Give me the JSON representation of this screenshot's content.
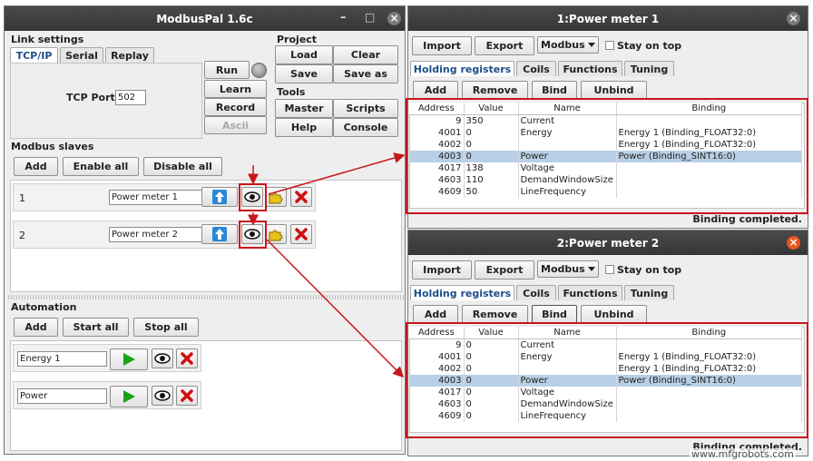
{
  "main_window": {
    "title": "ModbusPal 1.6c",
    "controls": {
      "minimize": "–",
      "maximize": "□",
      "close": "×"
    },
    "link_settings": {
      "label": "Link settings",
      "tabs": [
        "TCP/IP",
        "Serial",
        "Replay"
      ],
      "tcp_port_label": "TCP Port:",
      "tcp_port_value": "502",
      "buttons": {
        "run": "Run",
        "learn": "Learn",
        "record": "Record",
        "ascii": "Ascii"
      }
    },
    "project": {
      "label": "Project",
      "load": "Load",
      "clear": "Clear",
      "save": "Save",
      "save_as": "Save as"
    },
    "tools": {
      "label": "Tools",
      "master": "Master",
      "scripts": "Scripts",
      "help": "Help",
      "console": "Console"
    },
    "modbus_slaves": {
      "label": "Modbus slaves",
      "add": "Add",
      "enable_all": "Enable all",
      "disable_all": "Disable all",
      "slaves": [
        {
          "id": "1",
          "name": "Power meter 1"
        },
        {
          "id": "2",
          "name": "Power meter 2"
        }
      ]
    },
    "automation": {
      "label": "Automation",
      "add": "Add",
      "start_all": "Start all",
      "stop_all": "Stop all",
      "items": [
        {
          "name": "Energy 1"
        },
        {
          "name": "Power"
        }
      ]
    }
  },
  "slave_windows": [
    {
      "title": "1:Power meter 1",
      "import": "Import",
      "export": "Export",
      "protocol": "Modbus",
      "stay_on_top": "Stay on top",
      "tabs": [
        "Holding registers",
        "Coils",
        "Functions",
        "Tuning"
      ],
      "actions": {
        "add": "Add",
        "remove": "Remove",
        "bind": "Bind",
        "unbind": "Unbind"
      },
      "columns": [
        "Address",
        "Value",
        "Name",
        "Binding"
      ],
      "rows": [
        [
          "9",
          "350",
          "Current",
          ""
        ],
        [
          "4001",
          "0",
          "Energy",
          "Energy 1 (Binding_FLOAT32:0)"
        ],
        [
          "4002",
          "0",
          "",
          "Energy 1 (Binding_FLOAT32:0)"
        ],
        [
          "4003",
          "0",
          "Power",
          "Power (Binding_SINT16:0)"
        ],
        [
          "4017",
          "138",
          "Voltage",
          ""
        ],
        [
          "4603",
          "110",
          "DemandWindowSize",
          ""
        ],
        [
          "4609",
          "50",
          "LineFrequency",
          ""
        ]
      ],
      "status": "Binding completed."
    },
    {
      "title": "2:Power meter 2",
      "import": "Import",
      "export": "Export",
      "protocol": "Modbus",
      "stay_on_top": "Stay on top",
      "tabs": [
        "Holding registers",
        "Coils",
        "Functions",
        "Tuning"
      ],
      "actions": {
        "add": "Add",
        "remove": "Remove",
        "bind": "Bind",
        "unbind": "Unbind"
      },
      "columns": [
        "Address",
        "Value",
        "Name",
        "Binding"
      ],
      "rows": [
        [
          "9",
          "0",
          "Current",
          ""
        ],
        [
          "4001",
          "0",
          "Energy",
          "Energy 1 (Binding_FLOAT32:0)"
        ],
        [
          "4002",
          "0",
          "",
          "Energy 1 (Binding_FLOAT32:0)"
        ],
        [
          "4003",
          "0",
          "Power",
          "Power (Binding_SINT16:0)"
        ],
        [
          "4017",
          "0",
          "Voltage",
          ""
        ],
        [
          "4603",
          "0",
          "DemandWindowSize",
          ""
        ],
        [
          "4609",
          "0",
          "LineFrequency",
          ""
        ]
      ],
      "status": "Binding completed."
    }
  ],
  "selected_row_index": 3,
  "watermark": "www.mfgrobots.com",
  "colors": {
    "annotation_red": "#c8161d",
    "selected_row": "#b8cfe5",
    "titlebar": "#3c3c3c",
    "close_orange": "#e95420"
  }
}
